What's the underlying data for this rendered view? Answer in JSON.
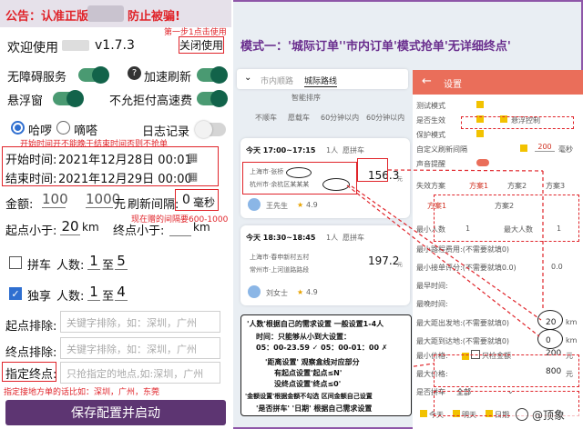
{
  "left": {
    "notice": {
      "prefix": "公告：认准正版",
      "suffix": "防止被骗!"
    },
    "welcome": "欢迎使用",
    "version": "v1.7.3",
    "close_button": "关闭使用",
    "step1_note": "第一步1点击使用",
    "toggles": {
      "accessibility": {
        "label": "无障碍服务",
        "on": true
      },
      "speed": {
        "label": "加速刷新",
        "on": true
      },
      "float": {
        "label": "悬浮窗",
        "on": true
      },
      "no_highway": {
        "label": "不允拒付高速费",
        "on": true
      },
      "log": {
        "label": "日志记录",
        "on": false
      }
    },
    "help_icon": "question-circle-icon",
    "radios": [
      {
        "label": "哈啰",
        "selected": true
      },
      {
        "label": "嘀嗒",
        "selected": false
      }
    ],
    "time_note": "开始时间开不能晚于结束时间否则不抢单",
    "start_label": "开始时间:",
    "start_value": "2021年12月28日 00:01",
    "end_label": "结束时间:",
    "end_value": "2021年12月29日 00:00",
    "amount_label": "金额:",
    "amount_min": "100",
    "amount_mid": "1000",
    "yuan": "元",
    "refresh_label": "刷新间隔:",
    "refresh_value": "0",
    "ms": "毫秒",
    "interval_note": "现在赠的间隔要600-1000",
    "start_lt_label": "起点小于:",
    "start_lt_value": "20",
    "km": "km",
    "end_lt_label": "终点小于:",
    "end_lt_value": "",
    "carpool": {
      "label": "拼车",
      "checked": false,
      "people_label": "人数:",
      "from": "1",
      "to_word": "至",
      "to": "5"
    },
    "exclusive": {
      "label": "独享",
      "checked": true,
      "people_label": "人数:",
      "from": "1",
      "to_word": "至",
      "to": "4"
    },
    "start_exclude_label": "起点排除:",
    "start_exclude_ph": "关键字排除，如：深圳，广州",
    "end_exclude_label": "终点排除:",
    "end_exclude_ph": "关键字排除，如：深圳，广州",
    "dest_label": "指定终点:",
    "dest_ph": "只抢指定的地点,如:深圳，广州",
    "dest_note": "指定接地方单的话比如：深圳，广州，东莞",
    "save_button": "保存配置并启动"
  },
  "right": {
    "headline": "模式一：'城际订单''市内订单'模式抢单'无详细终点'",
    "tabs": [
      "市内顺路",
      "城际路线"
    ],
    "chips": [
      "不顺车",
      "愿载车",
      "60分钟以内",
      "60分钟以内"
    ],
    "sort": "智能排序",
    "card1": {
      "time": "今天 17:00~17:15",
      "people": "1人",
      "tag": "愿拼车",
      "from": "上海市·张桥",
      "to": "杭州市·余杭区某某某",
      "price": "156.3",
      "unit": "元",
      "driver": "王先生",
      "rating": "4.9"
    },
    "card2": {
      "time": "今天 18:30~18:45",
      "people": "1人",
      "tag": "愿拼车",
      "from": "上海市·春申新村五村",
      "to": "常州市·上河道路路段",
      "price": "197.2",
      "unit": "元",
      "driver": "刘女士",
      "rating": "4.9"
    },
    "panel": {
      "title": "设置",
      "rows": [
        "测试模式",
        "是否生效",
        "保护模式",
        "自定义刷新间隔",
        "声音提醒",
        "失效方案"
      ],
      "suspend": "悬浮控制",
      "interval_value": "200",
      "interval_unit": "毫秒",
      "plans": [
        "方案1",
        "方案2",
        "方案3"
      ],
      "tab_plans": [
        "方案1",
        "方案2"
      ],
      "min_people": "最小人数",
      "min_people_val": "1",
      "max_people": "最大人数",
      "max_people_val": "1",
      "limits": [
        "最小路程费用:(不需要就填0)",
        "最小接单评分:(不需要就填0.0)",
        "最早时间:",
        "最晚时间:"
      ],
      "limit_vals": [
        "",
        "0.0",
        "",
        ""
      ],
      "max_start": "最大距出发地:(不需要就填0)",
      "max_start_val": "20",
      "max_end": "最大距到达地:(不需要就填0)",
      "max_end_val": "0",
      "min_price": "最小价格:",
      "min_price_val": "200",
      "max_price": "最大价格:",
      "max_price_val": "800",
      "price_unit": "元",
      "only_keyword": "只检金额",
      "carpool": "是否拼车",
      "carpool_val": "全部",
      "checks": [
        "今天",
        "明天",
        "日期"
      ]
    },
    "notes": [
      "'人数'根据自己的需求设置 一般设置1-4人",
      "时间：只能够从小到大设置：",
      "05：00-23.59 ✓ 05：00-01：00 ✗",
      "'距离设置' 观察盒线对应部分",
      "有起点设置'起点≤N'",
      "没终点设置'终点≤0'",
      "'金额设置'根据金额不勾选 区间金额自己设置",
      "'是否拼车' '日期' 根据自己需求设置"
    ],
    "watermark": "@顶象",
    "watermark_icon": "mascot-logo-icon"
  }
}
